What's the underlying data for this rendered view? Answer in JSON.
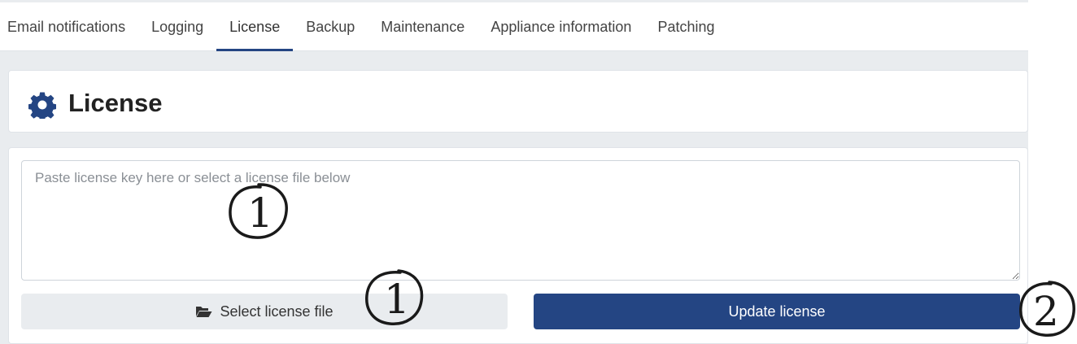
{
  "tabs": [
    {
      "label": "Email notifications",
      "active": false
    },
    {
      "label": "Logging",
      "active": false
    },
    {
      "label": "License",
      "active": true
    },
    {
      "label": "Backup",
      "active": false
    },
    {
      "label": "Maintenance",
      "active": false
    },
    {
      "label": "Appliance information",
      "active": false
    },
    {
      "label": "Patching",
      "active": false
    }
  ],
  "header": {
    "title": "License",
    "icon": "gear-icon"
  },
  "license_input": {
    "placeholder": "Paste license key here or select a license file below",
    "value": ""
  },
  "buttons": {
    "select_file_label": "Select license file",
    "select_file_icon": "folder-open-icon",
    "update_label": "Update license"
  },
  "annotations": [
    "1",
    "1",
    "2"
  ],
  "colors": {
    "accent": "#244583",
    "background": "#e9ecef",
    "select_button": "#e9ecef"
  }
}
